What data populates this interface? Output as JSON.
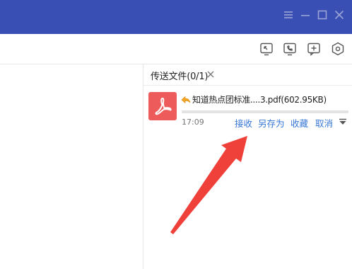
{
  "window": {
    "controls": [
      {
        "name": "menu-icon"
      },
      {
        "name": "minimize-icon"
      },
      {
        "name": "maximize-icon"
      },
      {
        "name": "close-icon"
      }
    ]
  },
  "toolbar": {
    "icons": [
      "screen-share-icon",
      "phone-call-icon",
      "add-chat-icon",
      "settings-hexagon-icon"
    ]
  },
  "transfer_tab": {
    "label": "传送文件(0/1)"
  },
  "file": {
    "name": "知道热点团标准....3.pdf(602.95KB)",
    "time": "17:09",
    "progress_percent": 0,
    "icon": "pdf-icon",
    "direction_icon": "incoming-arrow-icon"
  },
  "actions": {
    "receive": "接收",
    "save_as": "另存为",
    "collect": "收藏",
    "cancel": "取消"
  },
  "colors": {
    "titlebar": "#3a4fb4",
    "link": "#3878d6",
    "pdf_icon_bg": "#ee5b5b",
    "annotation_arrow": "#f0403a"
  }
}
